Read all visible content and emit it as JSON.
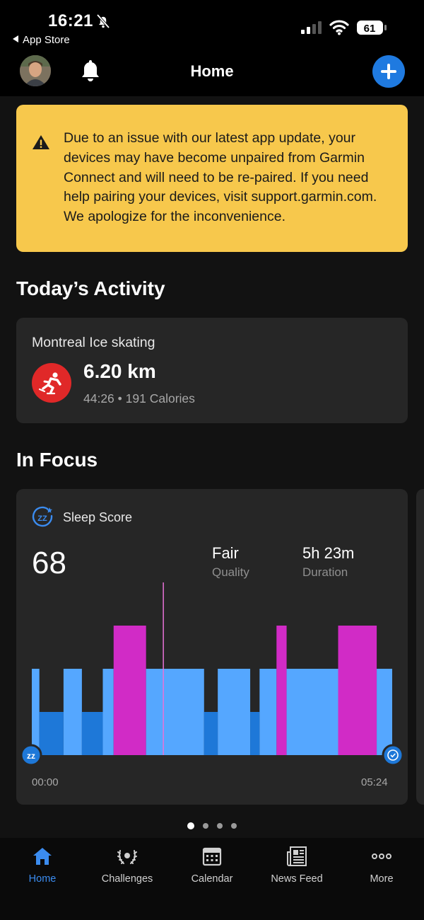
{
  "status_bar": {
    "time": "16:21",
    "back_label": "App Store",
    "battery": "61"
  },
  "header": {
    "title": "Home"
  },
  "alert": {
    "message": "Due to an issue with our latest app update, your devices may have become unpaired from Garmin Connect and will need to be re-paired. If you need help pairing your devices, visit support.garmin.com. We apologize for the inconvenience."
  },
  "todays_activity": {
    "section_title": "Today’s Activity",
    "name": "Montreal Ice skating",
    "distance": "6.20 km",
    "stats": "44:26 • 191 Calories",
    "icon": "ice-skating-icon",
    "icon_color": "#e02828"
  },
  "in_focus": {
    "section_title": "In Focus",
    "card_title": "Sleep Score",
    "score": "68",
    "quality_value": "Fair",
    "quality_label": "Quality",
    "duration_value": "5h 23m",
    "duration_label": "Duration",
    "start_time": "00:00",
    "end_time": "05:24",
    "page_count": 4,
    "active_page": 0
  },
  "colors": {
    "alert_bg": "#f7c84c",
    "accent": "#1f7ae0",
    "deep_sleep": "#1e78d8",
    "light_sleep": "#55a7ff",
    "rem_sleep": "#d12bc6",
    "awake": "#e872d9"
  },
  "chart_data": {
    "type": "timeline",
    "x_range": [
      "00:00",
      "05:24"
    ],
    "levels": [
      "deep",
      "light",
      "rem"
    ],
    "segments": [
      {
        "stage": "light",
        "start": 0.0,
        "end": 0.021
      },
      {
        "stage": "deep",
        "start": 0.021,
        "end": 0.088
      },
      {
        "stage": "light",
        "start": 0.088,
        "end": 0.139
      },
      {
        "stage": "deep",
        "start": 0.139,
        "end": 0.197
      },
      {
        "stage": "light",
        "start": 0.197,
        "end": 0.227
      },
      {
        "stage": "rem",
        "start": 0.227,
        "end": 0.317
      },
      {
        "stage": "light",
        "start": 0.317,
        "end": 0.478
      },
      {
        "stage": "deep",
        "start": 0.478,
        "end": 0.516
      },
      {
        "stage": "light",
        "start": 0.516,
        "end": 0.606
      },
      {
        "stage": "deep",
        "start": 0.606,
        "end": 0.632
      },
      {
        "stage": "light",
        "start": 0.632,
        "end": 0.679
      },
      {
        "stage": "rem",
        "start": 0.679,
        "end": 0.707
      },
      {
        "stage": "light",
        "start": 0.707,
        "end": 0.85
      },
      {
        "stage": "rem",
        "start": 0.85,
        "end": 0.957
      },
      {
        "stage": "light",
        "start": 0.957,
        "end": 1.0
      }
    ],
    "awake_markers": [
      0.365
    ]
  },
  "tabs": [
    {
      "label": "Home",
      "icon": "home-icon",
      "active": true
    },
    {
      "label": "Challenges",
      "icon": "laurel-icon",
      "active": false
    },
    {
      "label": "Calendar",
      "icon": "calendar-icon",
      "active": false
    },
    {
      "label": "News Feed",
      "icon": "newspaper-icon",
      "active": false
    },
    {
      "label": "More",
      "icon": "more-icon",
      "active": false
    }
  ]
}
